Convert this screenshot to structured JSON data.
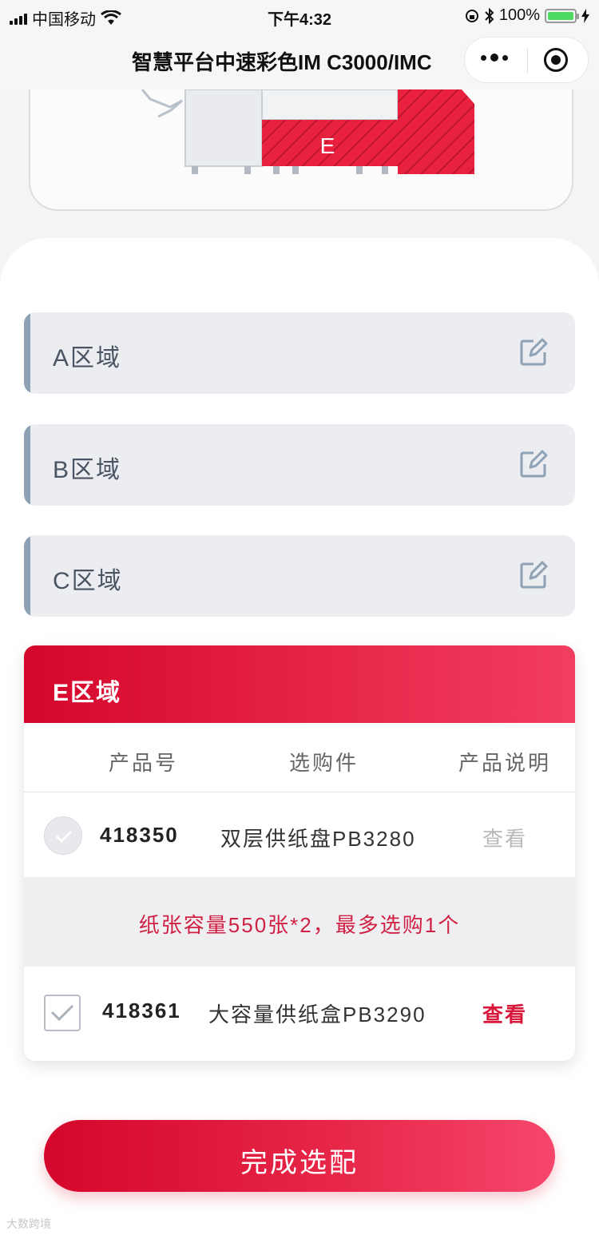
{
  "status_bar": {
    "carrier": "中国移动",
    "time": "下午4:32",
    "battery": "100%"
  },
  "nav": {
    "title": "智慧平台中速彩色IM C3000/IMC"
  },
  "diagram": {
    "zone_label": "E"
  },
  "zones": [
    {
      "label": "A区域"
    },
    {
      "label": "B区域"
    },
    {
      "label": "C区域"
    }
  ],
  "e_zone": {
    "title": "E区域",
    "columns": [
      "产品号",
      "选购件",
      "产品说明"
    ],
    "rows": [
      {
        "code": "418350",
        "name": "双层供纸盘PB3280",
        "action": "查看",
        "selected": false,
        "enabled": false
      },
      {
        "code": "418361",
        "name": "大容量供纸盒PB3290",
        "action": "查看",
        "selected": false,
        "enabled": true
      }
    ],
    "notice": "纸张容量550张*2，最多选购1个"
  },
  "finish_button": "完成选配",
  "watermark": "大数跨境",
  "colors": {
    "accent": "#e01a3f",
    "zone_bg": "#ebedf0",
    "zone_bar": "#8ea1b5"
  }
}
